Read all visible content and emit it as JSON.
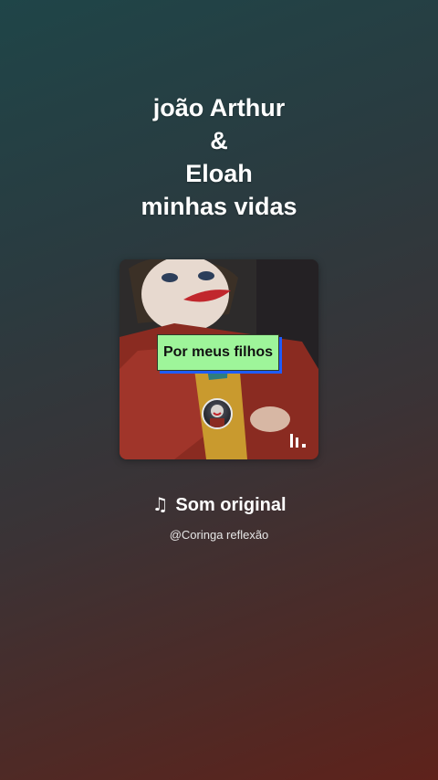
{
  "title": {
    "lines": [
      "joão Arthur",
      "&",
      "Eloah",
      "minhas vidas"
    ]
  },
  "cover": {
    "caption": "Por meus filhos",
    "caption_color": "#9ef59a",
    "avatar_icon": "joker-avatar",
    "play_icon": "sound-bars-icon"
  },
  "sound": {
    "icon": "music-note-icon",
    "label": "Som original",
    "author": "@Coringa reflexão"
  }
}
